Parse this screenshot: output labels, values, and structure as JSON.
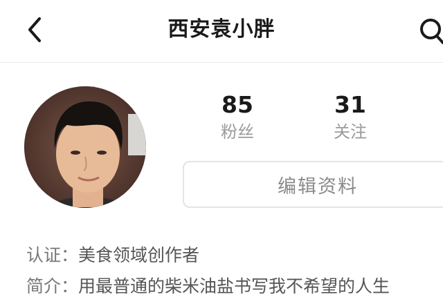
{
  "header": {
    "title": "西安袁小胖"
  },
  "icons": {
    "back": "chevron-left-icon",
    "search": "search-icon"
  },
  "profile": {
    "avatar": "avatar",
    "followers_count": "85",
    "followers_label": "粉丝",
    "following_count": "31",
    "following_label": "关注",
    "edit_button_label": "编辑资料"
  },
  "info": {
    "cert_key": "认证：",
    "cert_value": "美食领域创作者",
    "bio_key": "简介：",
    "bio_value": "用最普通的柴米油盐书写我不希望的人生"
  }
}
